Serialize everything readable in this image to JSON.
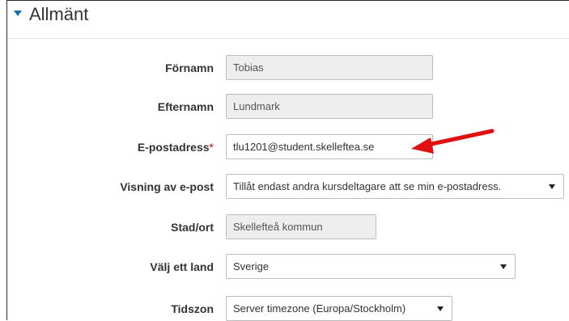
{
  "section": {
    "title": "Allmänt"
  },
  "fields": {
    "firstname": {
      "label": "Förnamn",
      "value": "Tobias"
    },
    "lastname": {
      "label": "Efternamn",
      "value": "Lundmark"
    },
    "email": {
      "label": "E-postadress",
      "required_mark": "*",
      "value": "tlu1201@student.skelleftea.se"
    },
    "email_display": {
      "label": "Visning av e-post",
      "value": "Tillåt endast andra kursdeltagare att se min e-postadress."
    },
    "city": {
      "label": "Stad/ort",
      "value": "Skellefteå kommun"
    },
    "country": {
      "label": "Välj ett land",
      "value": "Sverige"
    },
    "timezone": {
      "label": "Tidszon",
      "value": "Server timezone (Europa/Stockholm)"
    }
  },
  "annotation": {
    "arrow_color": "#e01010"
  },
  "colors": {
    "caret": "#1f6ea8",
    "readonly_bg": "#eeeeee",
    "required": "#cc0000"
  }
}
